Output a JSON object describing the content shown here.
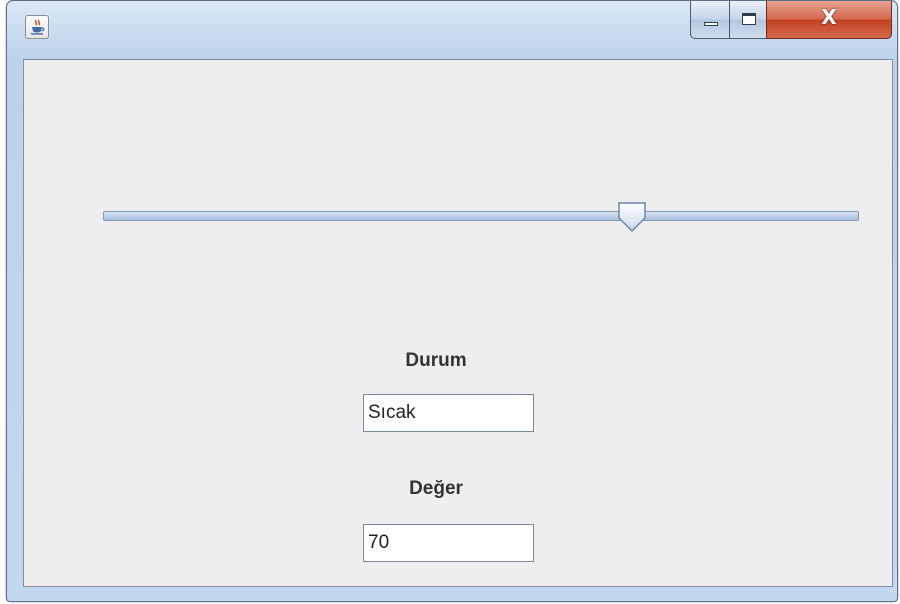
{
  "window": {
    "icon": "java-cup-icon",
    "controls": {
      "minimize": "minimize-icon",
      "maximize": "maximize-icon",
      "close": "close-icon",
      "close_glyph": "X"
    }
  },
  "slider": {
    "value": 70,
    "min": 0,
    "max": 100
  },
  "durum": {
    "label": "Durum",
    "value": "Sıcak"
  },
  "deger": {
    "label": "Değer",
    "value": "70"
  },
  "colors": {
    "close_button": "#c7452a",
    "content_background": "#eeeeee"
  }
}
